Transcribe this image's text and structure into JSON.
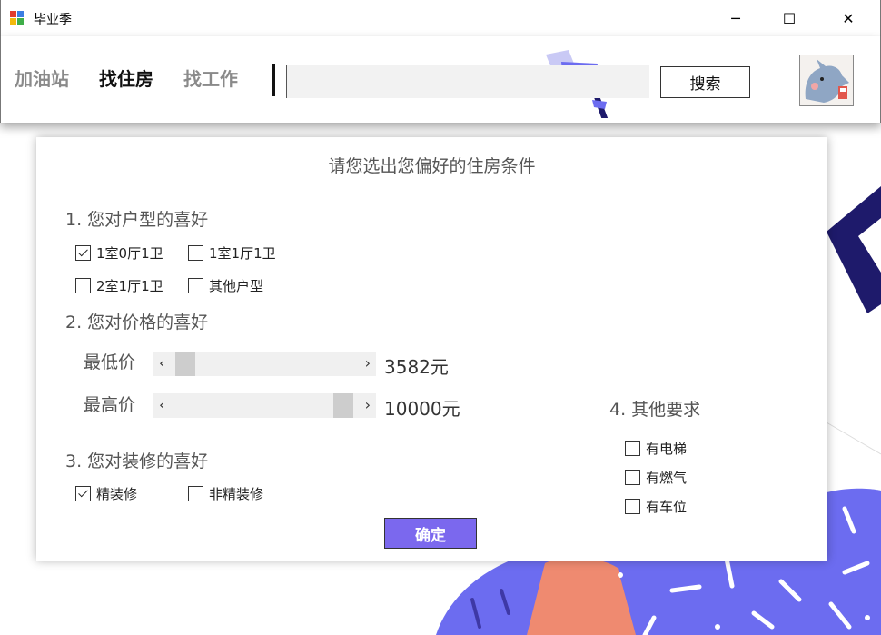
{
  "window": {
    "title": "毕业季",
    "minimize": "─",
    "maximize": "☐",
    "close": "✕"
  },
  "nav": {
    "items": [
      {
        "label": "加油站",
        "active": false
      },
      {
        "label": "找住房",
        "active": true
      },
      {
        "label": "找工作",
        "active": false
      }
    ]
  },
  "search": {
    "value": "",
    "button_label": "搜索"
  },
  "panel": {
    "title": "请您选出您偏好的住房条件",
    "section1": {
      "title": "1. 您对户型的喜好",
      "options": [
        {
          "label": "1室0厅1卫",
          "checked": true
        },
        {
          "label": "1室1厅1卫",
          "checked": false
        },
        {
          "label": "2室1厅1卫",
          "checked": false
        },
        {
          "label": "其他户型",
          "checked": false
        }
      ]
    },
    "section2": {
      "title": "2. 您对价格的喜好",
      "min": {
        "label": "最低价",
        "value": "3582元",
        "left_arrow": "‹",
        "right_arrow": "›",
        "level": 0.05
      },
      "max": {
        "label": "最高价",
        "value": "10000元",
        "left_arrow": "‹",
        "right_arrow": "›",
        "level": 1.0
      }
    },
    "section3": {
      "title": "3. 您对装修的喜好",
      "options": [
        {
          "label": "精装修",
          "checked": true
        },
        {
          "label": "非精装修",
          "checked": false
        }
      ]
    },
    "section4": {
      "title": "4. 其他要求",
      "options": [
        {
          "label": "有电梯",
          "checked": false
        },
        {
          "label": "有燃气",
          "checked": false
        },
        {
          "label": "有车位",
          "checked": false
        }
      ]
    },
    "confirm_label": "确定"
  },
  "colors": {
    "accent": "#7b68ee",
    "deco_purple": "#6c6cf0",
    "deco_navy": "#1e1a6b",
    "deco_coral": "#ef8a70"
  }
}
